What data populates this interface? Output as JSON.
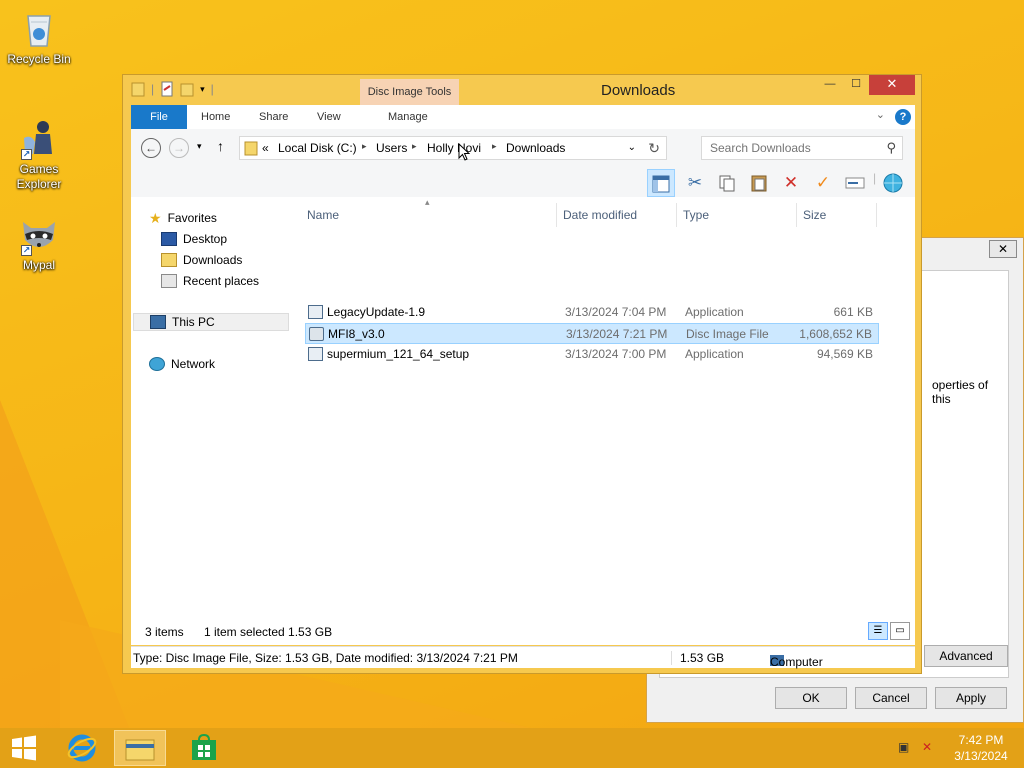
{
  "desktop": {
    "icons": [
      {
        "label": "Recycle Bin"
      },
      {
        "label": "Games Explorer"
      },
      {
        "label": "Mypal"
      }
    ]
  },
  "bg_dialog": {
    "close_glyph": "✕",
    "partial_text": "operties of this",
    "advanced_label": "Advanced",
    "ok_label": "OK",
    "cancel_label": "Cancel",
    "apply_label": "Apply"
  },
  "window": {
    "title": "Downloads",
    "context_tab_group": "Disc Image Tools",
    "controls": {
      "minimize": "—",
      "maximize": "☐",
      "close": "✕"
    },
    "tabs": {
      "file": "File",
      "home": "Home",
      "share": "Share",
      "view": "View",
      "manage": "Manage"
    },
    "address": {
      "overflow": "«",
      "segments": [
        "Local Disk (C:)",
        "Users",
        "Holly Novi",
        "Downloads"
      ]
    },
    "search": {
      "placeholder": "Search Downloads"
    },
    "nav": {
      "favorites": "Favorites",
      "desktop": "Desktop",
      "downloads": "Downloads",
      "recent": "Recent places",
      "this_pc": "This PC",
      "network": "Network"
    },
    "columns": {
      "name": "Name",
      "date": "Date modified",
      "type": "Type",
      "size": "Size"
    },
    "files": [
      {
        "name": "LegacyUpdate-1.9",
        "date": "3/13/2024 7:04 PM",
        "type": "Application",
        "size": "661 KB"
      },
      {
        "name": "MFI8_v3.0",
        "date": "3/13/2024 7:21 PM",
        "type": "Disc Image File",
        "size": "1,608,652 KB"
      },
      {
        "name": "supermium_121_64_setup",
        "date": "3/13/2024 7:00 PM",
        "type": "Application",
        "size": "94,569 KB"
      }
    ],
    "status": {
      "count": "3 items",
      "selection": "1 item selected  1.53 GB"
    },
    "details": {
      "summary": "Type: Disc Image File, Size: 1.53 GB, Date modified: 3/13/2024 7:21 PM",
      "size": "1.53 GB",
      "location": "Computer"
    }
  },
  "taskbar": {
    "time": "7:42 PM",
    "date": "3/13/2024"
  },
  "colors": {
    "accent": "#1979ca",
    "selection": "#cce8ff",
    "desktop": "#f6b416"
  }
}
